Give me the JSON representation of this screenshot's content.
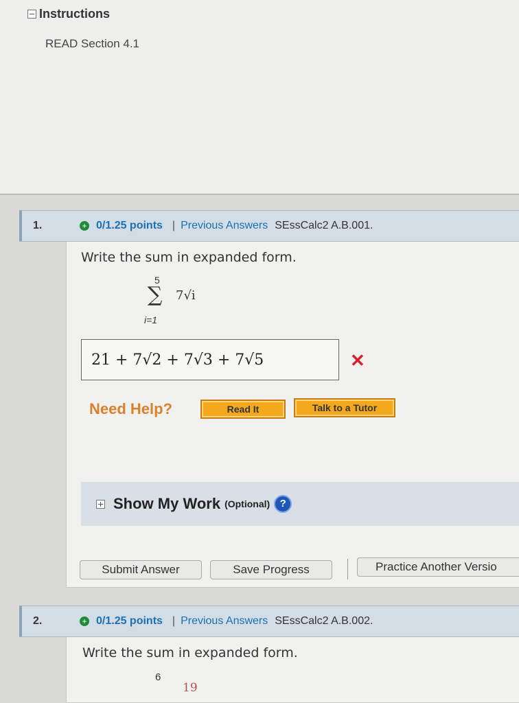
{
  "instructions": {
    "heading": "Instructions",
    "text": "READ Section 4.1"
  },
  "questions": [
    {
      "number": "1.",
      "points": "0/1.25 points",
      "separator": "|",
      "previous_answers": "Previous Answers",
      "code": "SEssCalc2 A.B.001.",
      "prompt": "Write the sum in expanded form.",
      "sum": {
        "upper": "5",
        "sigma": "∑",
        "expression": "7√i",
        "lower": "i=1"
      },
      "answer": "21 + 7√2 + 7√3 + 7√5",
      "status": "✕"
    },
    {
      "number": "2.",
      "points": "0/1.25 points",
      "separator": "|",
      "previous_answers": "Previous Answers",
      "code": "SEssCalc2 A.B.002.",
      "prompt": "Write the sum in expanded form.",
      "sum_upper": "6",
      "sum_partial": "19"
    }
  ],
  "help": {
    "label": "Need Help?",
    "read_it": "Read It",
    "tutor": "Talk to a Tutor"
  },
  "show_work": {
    "label": "Show My Work",
    "optional": "(Optional)",
    "help_icon": "?"
  },
  "actions": {
    "submit": "Submit Answer",
    "save": "Save Progress",
    "practice": "Practice Another Versio"
  },
  "colors": {
    "accent_blue": "#1d6fb3",
    "wrong_red": "#d6202c",
    "help_orange": "#d9822b",
    "button_orange": "#f4a81e"
  }
}
